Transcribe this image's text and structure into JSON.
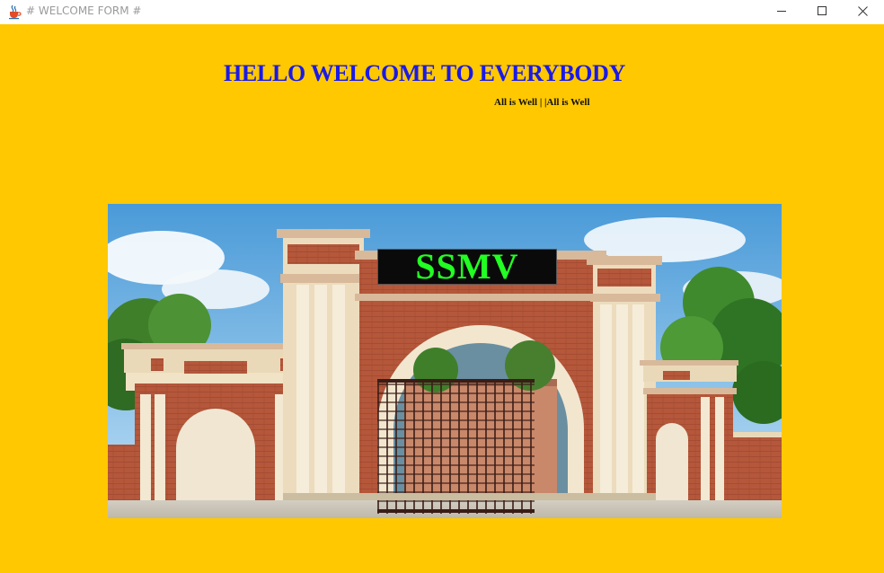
{
  "window": {
    "title": "# WELCOME FORM #",
    "app_icon": "java-coffee-cup-icon",
    "controls": [
      "minimize-icon",
      "maximize-icon",
      "close-icon"
    ]
  },
  "content": {
    "heading": "HELLO WELCOME TO EVERYBODY",
    "subtext": "All is Well  | |All is Well",
    "image": {
      "description_icon": "college-gate-photo",
      "sign_text": "SSMV"
    }
  },
  "colors": {
    "background": "#FFC800",
    "heading": "#1A1AE6",
    "sign_text": "#22FF22",
    "sign_background": "#0A0A0A"
  }
}
